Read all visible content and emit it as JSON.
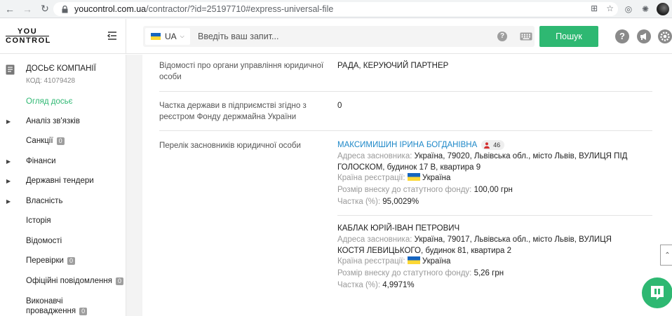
{
  "browser": {
    "url_domain": "youcontrol.com.ua",
    "url_path": "/contractor/?id=25197710#express-universal-file"
  },
  "header": {
    "logo_top": "YOU",
    "logo_bottom": "CONTROL",
    "lang": "UA",
    "search_placeholder": "Введіть ваш запит...",
    "search_button": "Пошук",
    "help_icon_label": "?"
  },
  "sidebar": {
    "dossier_title": "ДОСЬЄ КОМПАНІЇ",
    "dossier_code": "КОД: 41079428",
    "items": [
      {
        "label": "Огляд досьє",
        "active": true,
        "arrow": false,
        "badge": null
      },
      {
        "label": "Аналіз зв'язків",
        "active": false,
        "arrow": true,
        "badge": null
      },
      {
        "label": "Санкції",
        "active": false,
        "arrow": false,
        "badge": "0"
      },
      {
        "label": "Фінанси",
        "active": false,
        "arrow": true,
        "badge": null
      },
      {
        "label": "Державні тендери",
        "active": false,
        "arrow": true,
        "badge": null
      },
      {
        "label": "Власність",
        "active": false,
        "arrow": true,
        "badge": null
      },
      {
        "label": "Історія",
        "active": false,
        "arrow": false,
        "badge": null
      },
      {
        "label": "Відомості",
        "active": false,
        "arrow": false,
        "badge": null
      },
      {
        "label": "Перевірки",
        "active": false,
        "arrow": false,
        "badge": "0"
      },
      {
        "label": "Офіційні повідомлення",
        "active": false,
        "arrow": false,
        "badge": "0"
      },
      {
        "label_line1": "Виконавчі",
        "label_line2": "провадження",
        "active": false,
        "arrow": false,
        "badge": "0"
      }
    ]
  },
  "main": {
    "rows": [
      {
        "label": "Відомості про органи управління юридичної особи",
        "value": "РАДА, КЕРУЮЧИЙ ПАРТНЕР"
      },
      {
        "label": "Частка держави в підприємстві згідно з реєстром Фонду держмайна України",
        "value": "0"
      },
      {
        "label": "Перелік засновників юридичної особи"
      }
    ],
    "founders": [
      {
        "name": "МАКСИМИШИН ІРИНА БОГДАНІВНА",
        "badge_count": "46",
        "address_label": "Адреса засновника:",
        "address_value": "Україна, 79020, Львівська обл., місто Львів, ВУЛИЦЯ ПІД ГОЛОСКОМ, будинок 17 В, квартира 9",
        "country_label": "Країна реєстрації:",
        "country_value": "Україна",
        "capital_label": "Розмір внеску до статутного фонду:",
        "capital_value": "100,00 грн",
        "share_label": "Частка (%):",
        "share_value": "95,0029%"
      },
      {
        "name": "КАБЛАК ЮРІЙ-ІВАН ПЕТРОВИЧ",
        "address_label": "Адреса засновника:",
        "address_value": "Україна, 79017, Львівська обл., місто Львів, ВУЛИЦЯ КОСТЯ ЛЕВИЦЬКОГО, будинок 81, квартира 2",
        "country_label": "Країна реєстрації:",
        "country_value": "Україна",
        "capital_label": "Розмір внеску до статутного фонду:",
        "capital_value": "5,26 грн",
        "share_label": "Частка (%):",
        "share_value": "4,9971%"
      }
    ]
  },
  "colors": {
    "accent_green": "#2eb872",
    "link_blue": "#1e88c8",
    "ukraine_blue": "#1565c0",
    "ukraine_yellow": "#fdd835"
  }
}
